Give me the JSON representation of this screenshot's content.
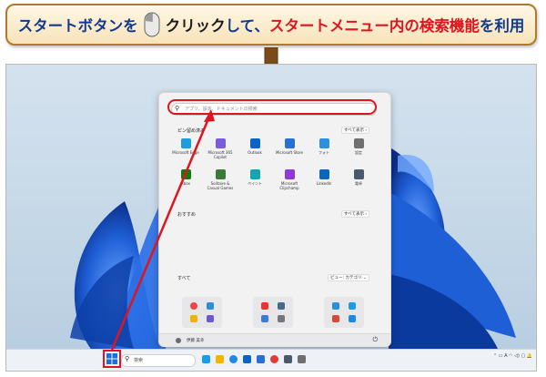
{
  "banner": {
    "part1": "スタートボタンを",
    "part2": "クリック",
    "part3": "して、",
    "part4": "スタートメニュー内の検索機能",
    "part5": "を利用"
  },
  "colors": {
    "accent_red": "#e0141e",
    "banner_blue": "#123a8c",
    "wallpaper_blue": "#1f5fd6"
  },
  "start_menu": {
    "search_placeholder": "アプリ、設定、ドキュメントの検索",
    "pinned_title": "ピン留め済み",
    "all_button": "すべて表示 ›",
    "pinned_apps": [
      {
        "label": "Microsoft Edge",
        "icon": "edge-icon",
        "color": "#1b9de2"
      },
      {
        "label": "Microsoft 365 Copilot",
        "icon": "copilot-icon",
        "color": "#7b5be0"
      },
      {
        "label": "Outlook",
        "icon": "outlook-icon",
        "color": "#0a64c8"
      },
      {
        "label": "Microsoft Store",
        "icon": "store-icon",
        "color": "#2a6fd6"
      },
      {
        "label": "フォト",
        "icon": "photos-icon",
        "color": "#2c8fe0"
      },
      {
        "label": "設定",
        "icon": "settings-icon",
        "color": "#6f6f6f"
      },
      {
        "label": "Xbox",
        "icon": "xbox-icon",
        "color": "#107c10"
      },
      {
        "label": "Solitaire & Casual Games",
        "icon": "solitaire-icon",
        "color": "#3d7a3a"
      },
      {
        "label": "ペイント",
        "icon": "paint-icon",
        "color": "#18a3b5"
      },
      {
        "label": "Microsoft Clipchamp",
        "icon": "clipchamp-icon",
        "color": "#8e3ad8"
      },
      {
        "label": "LinkedIn",
        "icon": "linkedin-icon",
        "color": "#0a66c2"
      },
      {
        "label": "電卓",
        "icon": "calculator-icon",
        "color": "#4a5a6a"
      }
    ],
    "recommended_title": "おすすめ",
    "recommended_button": "すべて表示 ›",
    "all_title": "すべて",
    "view_button": "ビュー: カテゴリ ⌄",
    "user_name": "伊藤 美幸"
  },
  "taskbar": {
    "search_label": "検索",
    "tray_text": "A"
  }
}
